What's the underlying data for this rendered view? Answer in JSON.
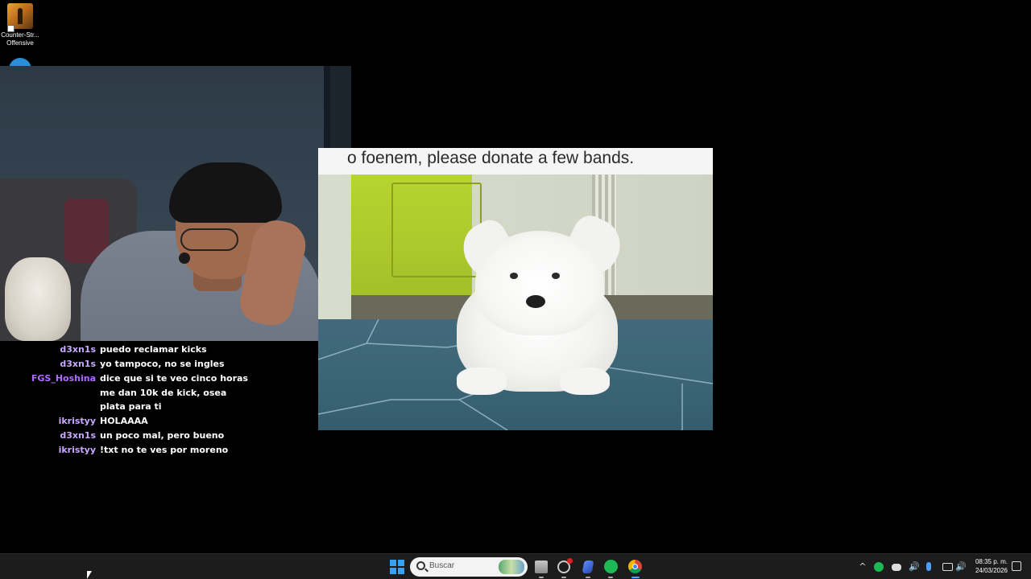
{
  "desktop": {
    "icons": [
      {
        "label_line1": "Counter-Str...",
        "label_line2": "Offensive",
        "icon": "counter-strike-icon"
      }
    ]
  },
  "stream": {
    "media_caption": "o foenem, please donate a few bands."
  },
  "chat": {
    "messages": [
      {
        "user": "d3xn1s",
        "text": "puedo reclamar kicks",
        "color": "#c9a7ff"
      },
      {
        "user": "d3xn1s",
        "text": "yo tampoco, no se ingles",
        "color": "#c9a7ff"
      },
      {
        "user": "FGS_Hoshina",
        "text": "dice que si te veo cinco horas me dan 10k de kick, osea plata para ti",
        "color": "#b06cff"
      },
      {
        "user": "ikristyy",
        "text": "HOLAAAA",
        "color": "#c9a7ff"
      },
      {
        "user": "d3xn1s",
        "text": "un poco mal, pero bueno",
        "color": "#c9a7ff"
      },
      {
        "user": "ikristyy",
        "text": "!txt no te ves por moreno",
        "color": "#c9a7ff"
      }
    ]
  },
  "taskbar": {
    "search_placeholder": "Buscar",
    "apps": [
      {
        "name": "start-icon"
      },
      {
        "name": "file-explorer-icon"
      },
      {
        "name": "steam-icon"
      },
      {
        "name": "app-icon"
      },
      {
        "name": "spotify-icon"
      },
      {
        "name": "chrome-icon"
      }
    ],
    "tray": {
      "chevron": "^",
      "time": "08:35 p. m.",
      "date": "24/03/2026"
    }
  },
  "colors": {
    "accent": "#3aa0f0",
    "spotify": "#1db954",
    "chat_user": "#c9a7ff",
    "chat_user_alt": "#b06cff"
  }
}
